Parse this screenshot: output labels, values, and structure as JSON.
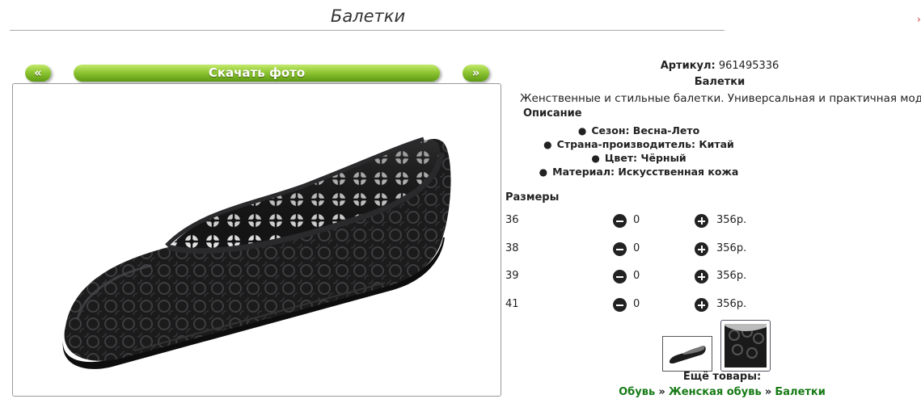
{
  "page": {
    "title": "Балетки"
  },
  "gallery": {
    "prev_label": "«",
    "download_label": "Скачать фото",
    "next_label": "»",
    "main_image": "black-perforated-ballet-flat-photo"
  },
  "product": {
    "article_label": "Артикул:",
    "article_value": "961495336",
    "name": "Балетки",
    "description": "Женственные и стильные балетки. Универсальная и практичная модель",
    "description_heading": "Описание",
    "specs": [
      "Сезон: Весна-Лето",
      "Страна-производитель: Китай",
      "Цвет: Чёрный",
      "Материал: Искусственная кожа"
    ]
  },
  "sizes": {
    "heading": "Размеры",
    "currency_suffix": "р.",
    "rows": [
      {
        "size": "36",
        "qty": "0",
        "price": "356р."
      },
      {
        "size": "38",
        "qty": "0",
        "price": "356р."
      },
      {
        "size": "39",
        "qty": "0",
        "price": "356р."
      },
      {
        "size": "41",
        "qty": "0",
        "price": "356р."
      }
    ]
  },
  "thumbnails": [
    "side-view-thumbnail",
    "closeup-thumbnail"
  ],
  "more": {
    "heading": "Ещё товары:",
    "breadcrumb": [
      "Обувь",
      "Женская обувь",
      "Балетки"
    ],
    "separator": "»"
  },
  "colors": {
    "button_green": "#8fc634",
    "link_green": "#167a16"
  }
}
